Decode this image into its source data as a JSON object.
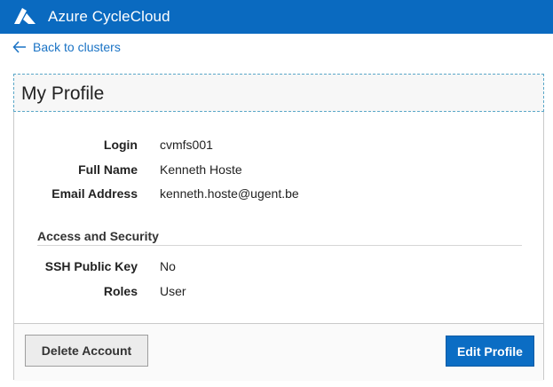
{
  "header": {
    "app_title": "Azure CycleCloud",
    "logo_icon": "azure-logo-icon",
    "background_color": "#0a6ac0"
  },
  "nav": {
    "back_label": "Back to clusters",
    "back_icon": "arrow-left-icon"
  },
  "profile": {
    "title": "My Profile",
    "fields": [
      {
        "label": "Login",
        "value": "cvmfs001"
      },
      {
        "label": "Full Name",
        "value": "Kenneth Hoste"
      },
      {
        "label": "Email Address",
        "value": "kenneth.hoste@ugent.be"
      }
    ],
    "security_section": {
      "heading": "Access and Security",
      "fields": [
        {
          "label": "SSH Public Key",
          "value": "No"
        },
        {
          "label": "Roles",
          "value": "User"
        }
      ]
    }
  },
  "actions": {
    "delete_label": "Delete Account",
    "edit_label": "Edit Profile",
    "edit_color": "#0b6dc4"
  }
}
